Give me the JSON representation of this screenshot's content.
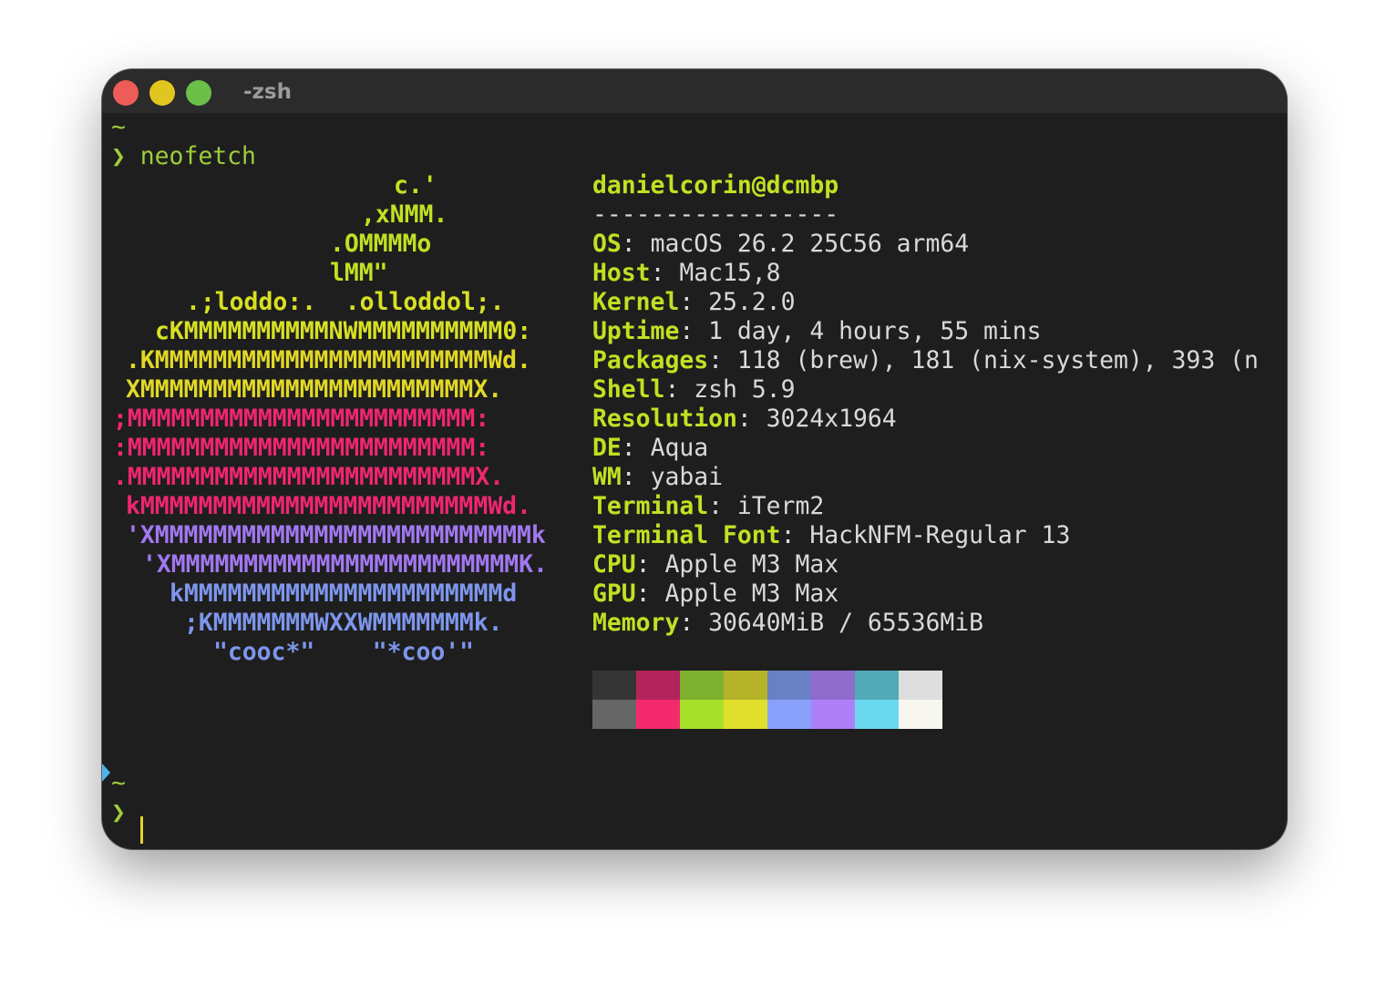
{
  "window": {
    "title": "-zsh"
  },
  "prompt1": {
    "dir": "~",
    "symbol": "❯",
    "command": "neofetch"
  },
  "logo": [
    {
      "text": "c.'",
      "color": "#c2e023"
    },
    {
      "text": ",xNMM.",
      "color": "#c2e023"
    },
    {
      "text": ".OMMMMo",
      "color": "#c2e023"
    },
    {
      "text": "lMM\"",
      "color": "#c2e023"
    },
    {
      "text": ".;loddo:.  .olloddol;.",
      "color": "#d8e023"
    },
    {
      "text": "cKMMMMMMMMMMNWMMMMMMMMMM0:",
      "color": "#d8e023"
    },
    {
      "text": ".KMMMMMMMMMMMMMMMMMMMMMMMWd.",
      "color": "#e2d826"
    },
    {
      "text": "XMMMMMMMMMMMMMMMMMMMMMMMX.",
      "color": "#e2d826"
    },
    {
      "text": ";MMMMMMMMMMMMMMMMMMMMMMMM:",
      "color": "#f0266f"
    },
    {
      "text": ":MMMMMMMMMMMMMMMMMMMMMMMM:",
      "color": "#f0266f"
    },
    {
      "text": ".MMMMMMMMMMMMMMMMMMMMMMMMX.",
      "color": "#f0266f"
    },
    {
      "text": "kMMMMMMMMMMMMMMMMMMMMMMMMWd.",
      "color": "#f0266f"
    },
    {
      "text": "'XMMMMMMMMMMMMMMMMMMMMMMMMMMk",
      "color": "#a278f0"
    },
    {
      "text": "'XMMMMMMMMMMMMMMMMMMMMMMMMK.",
      "color": "#a278f0"
    },
    {
      "text": "kMMMMMMMMMMMMMMMMMMMMMMd",
      "color": "#7e96ec"
    },
    {
      "text": ";KMMMMMMMWXXWMMMMMMMk.",
      "color": "#7e96ec"
    },
    {
      "text": "\"cooc*\"    \"*coo'\"",
      "color": "#7e96ec"
    }
  ],
  "info": {
    "user_host": "danielcorin@dcmbp",
    "separator": "-----------------",
    "fields": [
      {
        "key": "OS",
        "value": "macOS 26.2 25C56 arm64"
      },
      {
        "key": "Host",
        "value": "Mac15,8"
      },
      {
        "key": "Kernel",
        "value": "25.2.0"
      },
      {
        "key": "Uptime",
        "value": "1 day, 4 hours, 55 mins"
      },
      {
        "key": "Packages",
        "value": "118 (brew), 181 (nix-system), 393 (n"
      },
      {
        "key": "Shell",
        "value": "zsh 5.9"
      },
      {
        "key": "Resolution",
        "value": "3024x1964"
      },
      {
        "key": "DE",
        "value": "Aqua"
      },
      {
        "key": "WM",
        "value": "yabai"
      },
      {
        "key": "Terminal",
        "value": "iTerm2"
      },
      {
        "key": "Terminal Font",
        "value": "HackNFM-Regular 13"
      },
      {
        "key": "CPU",
        "value": "Apple M3 Max"
      },
      {
        "key": "GPU",
        "value": "Apple M3 Max"
      },
      {
        "key": "Memory",
        "value": "30640MiB / 65536MiB"
      }
    ]
  },
  "palette": {
    "row1": [
      "#353535",
      "#b3245a",
      "#7eb02f",
      "#b5b32a",
      "#6a80c5",
      "#8f6ccc",
      "#52a9b8",
      "#dedede"
    ],
    "row2": [
      "#666666",
      "#f42a6e",
      "#a7df2a",
      "#e0df2b",
      "#8aa1fb",
      "#ad80f8",
      "#6ad9ef",
      "#f7f6ef"
    ]
  },
  "prompt2": {
    "dir": "~",
    "symbol": "❯"
  },
  "colors": {
    "accent": "#c2e023",
    "prompt": "#9fcd3a",
    "cursor": "#e6d12c",
    "marker": "#4fb4e8"
  }
}
